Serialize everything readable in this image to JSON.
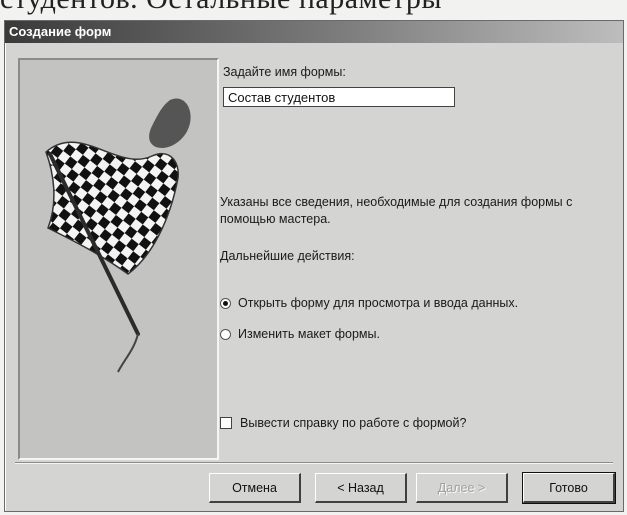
{
  "book_text": "студентов. Остальные параметры",
  "dialog": {
    "title": "Создание форм",
    "prompt_label": "Задайте имя формы:",
    "form_name_value": "Состав студентов",
    "info_text": "Указаны все сведения, необходимые для создания формы с помощью мастера.",
    "next_actions_label": "Дальнейшие действия:",
    "options": [
      {
        "label": "Открыть форму для просмотра и ввода данных.",
        "selected": true
      },
      {
        "label": "Изменить макет формы.",
        "selected": false
      }
    ],
    "help_checkbox": {
      "label": "Вывести справку по работе с формой?",
      "checked": false
    },
    "buttons": {
      "cancel": "Отмена",
      "back": "< Назад",
      "next": "Далее >",
      "finish": "Готово"
    },
    "picture_icon": "checkered-flag-icon"
  }
}
